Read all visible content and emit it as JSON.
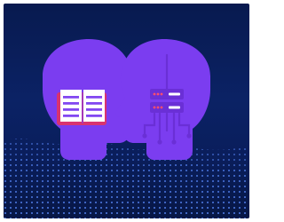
{
  "image": {
    "colors": {
      "background_top": "#081a4f",
      "background_bottom": "#071746",
      "head_fill": "#7b3df0",
      "book_cover": "#d9336f",
      "book_pages": "#ffffff",
      "book_lines": "#7b3df0",
      "server_panel": "#6a2fd6",
      "server_line": "#ffffff",
      "server_leds": "#ff4d6d",
      "wave_dots": "#5a8bff"
    },
    "icons": {
      "left_head": "book-head-icon",
      "right_head": "server-head-icon"
    }
  }
}
